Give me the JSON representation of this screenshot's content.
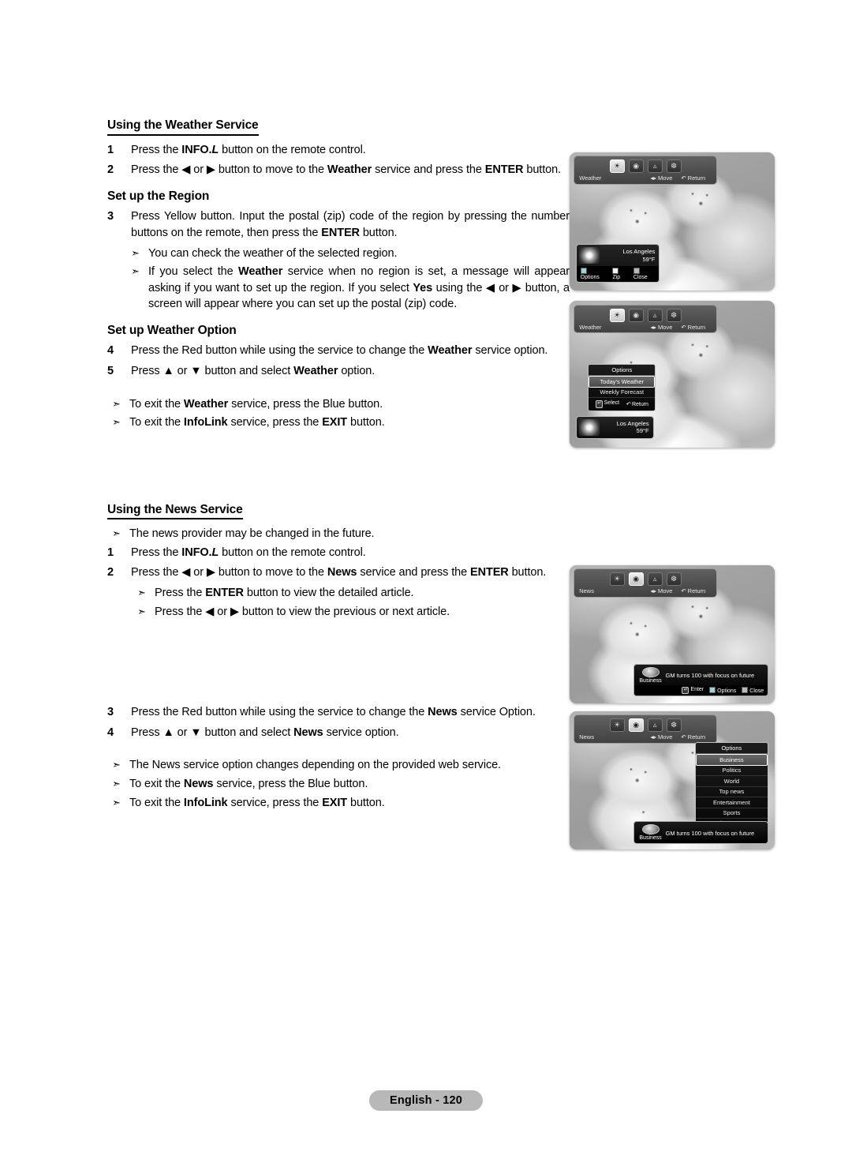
{
  "page": {
    "footer_label": "English - 120"
  },
  "weather_section": {
    "heading": "Using the Weather Service",
    "steps": [
      {
        "num": "1",
        "text": "Press the INFO.L button on the remote control."
      },
      {
        "num": "2",
        "text": "Press the ◀ or ▶ button to move to the Weather service and press the ENTER button."
      }
    ],
    "region_heading": "Set up the Region",
    "region_step": {
      "num": "3",
      "text": "Press Yellow button. Input the postal (zip) code of the region by pressing the number buttons on the remote, then press the ENTER button."
    },
    "region_notes": [
      "You can check the weather of the selected region.",
      "If you select the Weather service when no region is set, a message will appear asking if you want to set up the region. If you select Yes using the ◀ or ▶ button, a screen will appear where you can set up the postal (zip) code."
    ],
    "option_heading": "Set up Weather Option",
    "option_steps": [
      {
        "num": "4",
        "text": "Press the Red button while using the service to change the Weather service option."
      },
      {
        "num": "5",
        "text": "Press ▲ or ▼ button and select Weather option."
      }
    ],
    "exit_notes": [
      "To exit the Weather service, press the Blue button.",
      "To exit the InfoLink service, press the EXIT button."
    ]
  },
  "news_section": {
    "heading": "Using the News Service",
    "intro_note": "The news provider may be changed in the future.",
    "steps": [
      {
        "num": "1",
        "text": "Press the INFO.L button on the remote control."
      },
      {
        "num": "2",
        "text": "Press the ◀ or ▶ button to move to the News service and press the ENTER button."
      }
    ],
    "sub_notes": [
      "Press the ENTER button to view the detailed article.",
      "Press the ◀ or ▶ button to view the previous or next article."
    ],
    "option_steps": [
      {
        "num": "3",
        "text": "Press the Red button while using the service to change the News service Option."
      },
      {
        "num": "4",
        "text": "Press ▲ or ▼ button and select News service option."
      }
    ],
    "exit_notes": [
      "The News service option changes depending on the provided web service.",
      "To exit the News service, press the Blue button.",
      "To exit the InfoLink service, press the EXIT button."
    ]
  },
  "screens": {
    "bar_hints": {
      "move": "Move",
      "return": "Return",
      "select": "Select",
      "enter": "Enter"
    },
    "weather_main": {
      "service_label": "Weather",
      "icons": [
        "photo-icon",
        "news-icon",
        "stocks-icon",
        "weather-icon"
      ],
      "selected_icon_index": 0,
      "widget": {
        "city": "Los Angeles",
        "temperature": "59°F",
        "buttons": [
          "Options",
          "Zip",
          "Close"
        ]
      }
    },
    "weather_options": {
      "service_label": "Weather",
      "icons": [
        "photo-icon",
        "news-icon",
        "stocks-icon",
        "weather-icon"
      ],
      "selected_icon_index": 0,
      "menu": {
        "title": "Options",
        "items": [
          "Today's Weather",
          "Weekly Forecast"
        ],
        "selected_index": 0
      },
      "widget": {
        "city": "Los Angeles",
        "temperature": "59°F"
      }
    },
    "news_main": {
      "service_label": "News",
      "icons": [
        "photo-icon",
        "news-icon",
        "stocks-icon",
        "weather-icon"
      ],
      "selected_icon_index": 1,
      "ticker": {
        "category": "Business",
        "headline": "GM turns 100 with focus on future",
        "buttons": [
          "Enter",
          "Options",
          "Close"
        ]
      }
    },
    "news_options": {
      "service_label": "News",
      "icons": [
        "photo-icon",
        "news-icon",
        "stocks-icon",
        "weather-icon"
      ],
      "selected_icon_index": 1,
      "menu": {
        "title": "Options",
        "items": [
          "Business",
          "Politics",
          "World",
          "Top news",
          "Entertainment",
          "Sports"
        ],
        "selected_index": 0
      },
      "ticker": {
        "category": "Business",
        "headline": "GM turns 100 with focus on future"
      }
    }
  }
}
